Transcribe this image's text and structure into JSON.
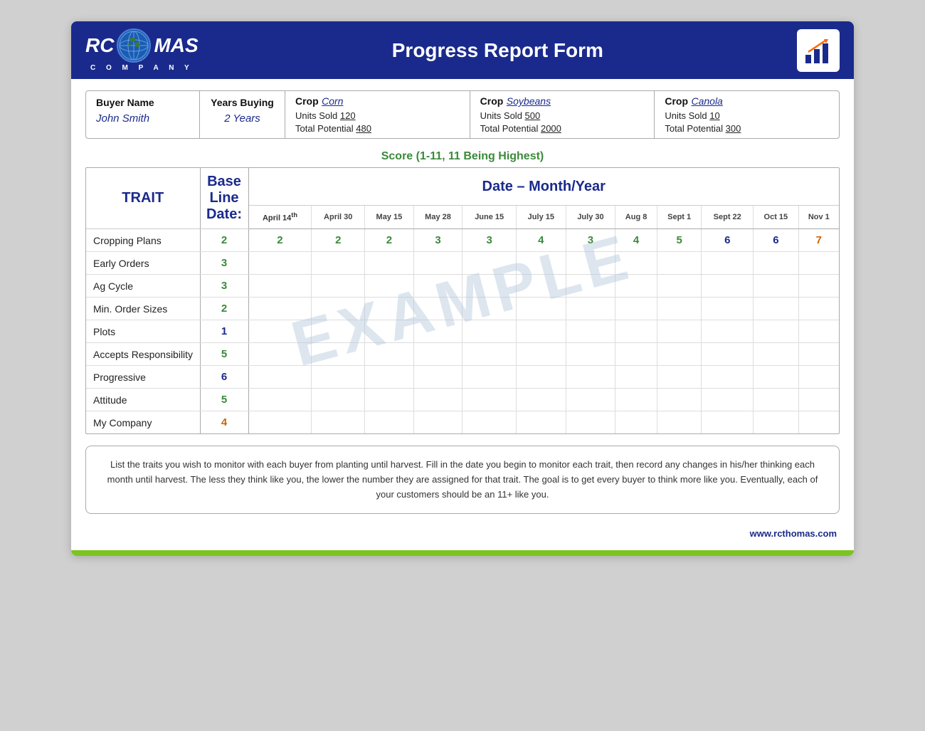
{
  "header": {
    "title": "Progress Report Form",
    "logo_rc": "RC",
    "logo_mas": "MAS",
    "logo_company": "C  O  M  P  A  N  Y"
  },
  "buyer": {
    "name_label": "Buyer Name",
    "name_value": "John Smith",
    "years_label": "Years Buying",
    "years_value": "2 Years",
    "crops": [
      {
        "label": "Crop",
        "name": "Corn",
        "units_sold_label": "Units Sold",
        "units_sold_value": "120",
        "total_potential_label": "Total Potential",
        "total_potential_value": "480"
      },
      {
        "label": "Crop",
        "name": "Soybeans",
        "units_sold_label": "Units Sold",
        "units_sold_value": "500",
        "total_potential_label": "Total Potential",
        "total_potential_value": "2000"
      },
      {
        "label": "Crop",
        "name": "Canola",
        "units_sold_label": "Units Sold",
        "units_sold_value": "10",
        "total_potential_label": "Total Potential",
        "total_potential_value": "300"
      }
    ]
  },
  "score_label": "Score (1-11, 11 Being Highest)",
  "table": {
    "trait_header": "TRAIT",
    "baseline_header": "Base Line Date:",
    "date_header": "Date – Month/Year",
    "columns": [
      "April 14th",
      "April 30",
      "May 15",
      "May 28",
      "June 15",
      "July 15",
      "July 30",
      "Aug 8",
      "Sept 1",
      "Sept 22",
      "Oct 15",
      "Nov 1"
    ],
    "rows": [
      {
        "trait": "Cropping Plans",
        "baseline": "2",
        "baseline_color": "green",
        "values": [
          "2",
          "2",
          "2",
          "3",
          "3",
          "4",
          "3",
          "4",
          "5",
          "6",
          "6",
          "7"
        ],
        "colors": [
          "green",
          "green",
          "green",
          "green",
          "green",
          "green",
          "green",
          "green",
          "green",
          "blue",
          "blue",
          "orange"
        ]
      },
      {
        "trait": "Early Orders",
        "baseline": "3",
        "baseline_color": "green",
        "values": [
          "",
          "",
          "",
          "",
          "",
          "",
          "",
          "",
          "",
          "",
          "",
          ""
        ]
      },
      {
        "trait": "Ag Cycle",
        "baseline": "3",
        "baseline_color": "green",
        "values": [
          "",
          "",
          "",
          "",
          "",
          "",
          "",
          "",
          "",
          "",
          "",
          ""
        ]
      },
      {
        "trait": "Min. Order Sizes",
        "baseline": "2",
        "baseline_color": "green",
        "values": [
          "",
          "",
          "",
          "",
          "",
          "",
          "",
          "",
          "",
          "",
          "",
          ""
        ]
      },
      {
        "trait": "Plots",
        "baseline": "1",
        "baseline_color": "blue",
        "values": [
          "",
          "",
          "",
          "",
          "",
          "",
          "",
          "",
          "",
          "",
          "",
          ""
        ]
      },
      {
        "trait": "Accepts Responsibility",
        "baseline": "5",
        "baseline_color": "green",
        "values": [
          "",
          "",
          "",
          "",
          "",
          "",
          "",
          "",
          "",
          "",
          "",
          ""
        ]
      },
      {
        "trait": "Progressive",
        "baseline": "6",
        "baseline_color": "blue",
        "values": [
          "",
          "",
          "",
          "",
          "",
          "",
          "",
          "",
          "",
          "",
          "",
          ""
        ]
      },
      {
        "trait": "Attitude",
        "baseline": "5",
        "baseline_color": "green",
        "values": [
          "",
          "",
          "",
          "",
          "",
          "",
          "",
          "",
          "",
          "",
          "",
          ""
        ]
      },
      {
        "trait": "My Company",
        "baseline": "4",
        "baseline_color": "orange",
        "values": [
          "",
          "",
          "",
          "",
          "",
          "",
          "",
          "",
          "",
          "",
          "",
          ""
        ]
      }
    ]
  },
  "description": "List the traits you wish to monitor with each buyer from planting until harvest.  Fill in the date you begin to monitor each trait, then\nrecord any changes in his/her thinking each month until harvest.  The less they think like you, the lower the number they are assigned\nfor that trait.  The goal is to get every buyer to think more like you.  Eventually, each of your customers should be an 11+ like you.",
  "footer_url": "www.rcthomas.com",
  "example_watermark": "EXAMPLE"
}
